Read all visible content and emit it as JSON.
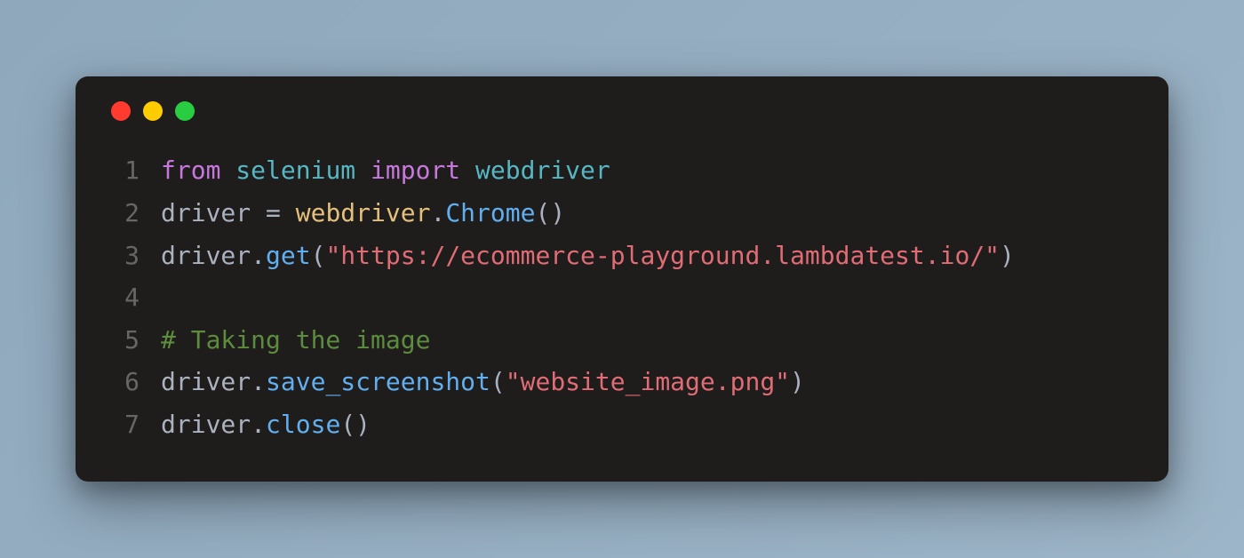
{
  "window": {
    "traffic_lights": [
      "red",
      "yellow",
      "green"
    ]
  },
  "code": {
    "lines": [
      {
        "number": "1",
        "tokens": [
          {
            "text": "from",
            "class": "tok-keyword"
          },
          {
            "text": " ",
            "class": "tok-default"
          },
          {
            "text": "selenium",
            "class": "tok-module"
          },
          {
            "text": " ",
            "class": "tok-default"
          },
          {
            "text": "import",
            "class": "tok-keyword"
          },
          {
            "text": " ",
            "class": "tok-default"
          },
          {
            "text": "webdriver",
            "class": "tok-module"
          }
        ]
      },
      {
        "number": "2",
        "tokens": [
          {
            "text": "driver",
            "class": "tok-identifier"
          },
          {
            "text": " ",
            "class": "tok-default"
          },
          {
            "text": "=",
            "class": "tok-operator"
          },
          {
            "text": " ",
            "class": "tok-default"
          },
          {
            "text": "webdriver",
            "class": "tok-property"
          },
          {
            "text": ".",
            "class": "tok-default"
          },
          {
            "text": "Chrome",
            "class": "tok-method"
          },
          {
            "text": "()",
            "class": "tok-paren"
          }
        ]
      },
      {
        "number": "3",
        "tokens": [
          {
            "text": "driver",
            "class": "tok-identifier"
          },
          {
            "text": ".",
            "class": "tok-default"
          },
          {
            "text": "get",
            "class": "tok-method"
          },
          {
            "text": "(",
            "class": "tok-paren"
          },
          {
            "text": "\"https://ecommerce-playground.lambdatest.io/\"",
            "class": "tok-string"
          },
          {
            "text": ")",
            "class": "tok-paren"
          }
        ]
      },
      {
        "number": "4",
        "tokens": []
      },
      {
        "number": "5",
        "tokens": [
          {
            "text": "# Taking the image",
            "class": "tok-comment"
          }
        ]
      },
      {
        "number": "6",
        "tokens": [
          {
            "text": "driver",
            "class": "tok-identifier"
          },
          {
            "text": ".",
            "class": "tok-default"
          },
          {
            "text": "save_screenshot",
            "class": "tok-method"
          },
          {
            "text": "(",
            "class": "tok-paren"
          },
          {
            "text": "\"website_image.png\"",
            "class": "tok-string"
          },
          {
            "text": ")",
            "class": "tok-paren"
          }
        ]
      },
      {
        "number": "7",
        "tokens": [
          {
            "text": "driver",
            "class": "tok-identifier"
          },
          {
            "text": ".",
            "class": "tok-default"
          },
          {
            "text": "close",
            "class": "tok-method"
          },
          {
            "text": "()",
            "class": "tok-paren"
          }
        ]
      }
    ]
  }
}
